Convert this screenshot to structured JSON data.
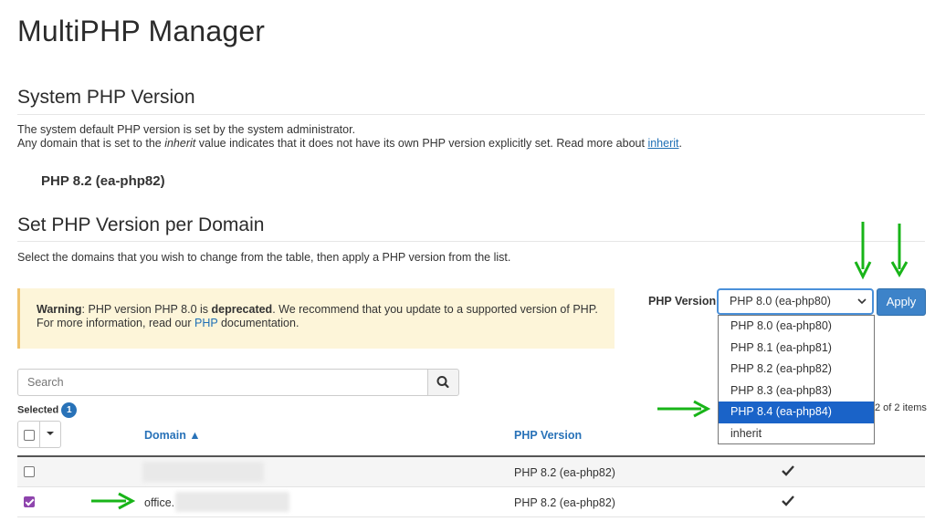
{
  "page": {
    "title": "MultiPHP Manager"
  },
  "system": {
    "title": "System PHP Version",
    "desc_line1": "The system default PHP version is set by the system administrator.",
    "desc_line2_a": "Any domain that is set to the ",
    "desc_line2_em": "inherit",
    "desc_line2_b": " value indicates that it does not have its own PHP version explicitly set. Read more about ",
    "desc_line2_link": "inherit",
    "desc_line2_end": ".",
    "version": "PHP 8.2 (ea-php82)"
  },
  "per_domain": {
    "title": "Set PHP Version per Domain",
    "desc": "Select the domains that you wish to change from the table, then apply a PHP version from the list."
  },
  "warning": {
    "label": "Warning",
    "text_a": ": PHP version PHP 8.0 is ",
    "deprecated": "deprecated",
    "text_b": ". We recommend that you update to a supported version of PHP.",
    "line2_a": "For more information, read our ",
    "line2_link": "PHP",
    "line2_b": " documentation."
  },
  "php_version": {
    "label": "PHP Version",
    "selected": "PHP 8.0 (ea-php80)",
    "apply_label": "Apply",
    "options": [
      "PHP 8.0 (ea-php80)",
      "PHP 8.1 (ea-php81)",
      "PHP 8.2 (ea-php82)",
      "PHP 8.3 (ea-php83)",
      "PHP 8.4 (ea-php84)",
      "inherit"
    ],
    "highlighted_option": "PHP 8.4 (ea-php84)"
  },
  "search": {
    "placeholder": "Search"
  },
  "selection": {
    "label": "Selected",
    "count": "1",
    "items_count": "2 of 2 items"
  },
  "table": {
    "col_domain": "Domain ▲",
    "col_php": "PHP Version",
    "rows": [
      {
        "domain": "",
        "php": "PHP 8.2 (ea-php82)",
        "checked": false
      },
      {
        "domain": "office.",
        "php": "PHP 8.2 (ea-php82)",
        "checked": true
      }
    ]
  },
  "colors": {
    "accent": "#2872b8",
    "selected_option": "#1a63c8",
    "arrow": "#18b418",
    "warning_bg": "#fdf5d9"
  }
}
